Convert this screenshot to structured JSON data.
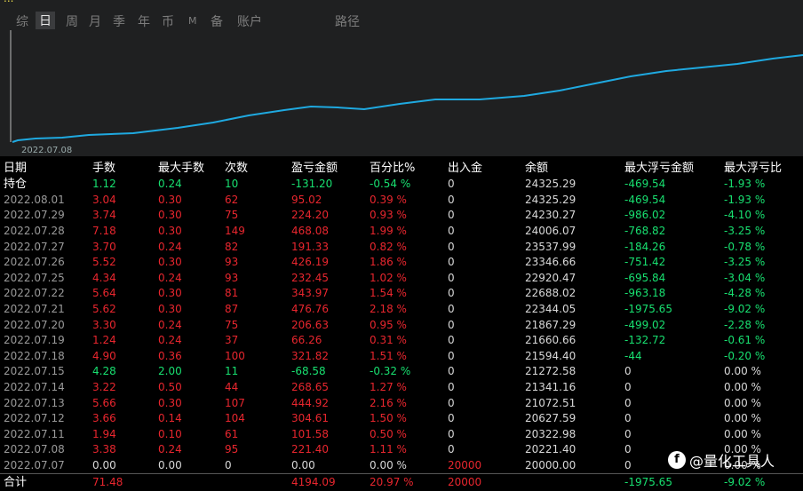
{
  "window": {
    "title": "..."
  },
  "tabs": [
    "综",
    "日",
    "周",
    "月",
    "季",
    "年",
    "币",
    "M",
    "备",
    "账户",
    "路径"
  ],
  "active_tab": "日",
  "chart": {
    "start_label": "2022.07.08",
    "line_color": "#1fa9e0"
  },
  "table": {
    "headers": [
      "日期",
      "手数",
      "最大手数",
      "次数",
      "盈亏金额",
      "百分比%",
      "出入金",
      "余额",
      "最大浮亏金额",
      "最大浮亏比"
    ],
    "hold_row": [
      "持仓",
      "1.12",
      "0.24",
      "10",
      "-131.20",
      "-0.54 %",
      "0",
      "24325.29",
      "-469.54",
      "-1.93 %"
    ],
    "rows": [
      [
        "2022.08.01",
        "3.04",
        "0.30",
        "62",
        "95.02",
        "0.39 %",
        "0",
        "24325.29",
        "-469.54",
        "-1.93 %"
      ],
      [
        "2022.07.29",
        "3.74",
        "0.30",
        "75",
        "224.20",
        "0.93 %",
        "0",
        "24230.27",
        "-986.02",
        "-4.10 %"
      ],
      [
        "2022.07.28",
        "7.18",
        "0.30",
        "149",
        "468.08",
        "1.99 %",
        "0",
        "24006.07",
        "-768.82",
        "-3.25 %"
      ],
      [
        "2022.07.27",
        "3.70",
        "0.24",
        "82",
        "191.33",
        "0.82 %",
        "0",
        "23537.99",
        "-184.26",
        "-0.78 %"
      ],
      [
        "2022.07.26",
        "5.52",
        "0.30",
        "93",
        "426.19",
        "1.86 %",
        "0",
        "23346.66",
        "-751.42",
        "-3.25 %"
      ],
      [
        "2022.07.25",
        "4.34",
        "0.24",
        "93",
        "232.45",
        "1.02 %",
        "0",
        "22920.47",
        "-695.84",
        "-3.04 %"
      ],
      [
        "2022.07.22",
        "5.64",
        "0.30",
        "81",
        "343.97",
        "1.54 %",
        "0",
        "22688.02",
        "-963.18",
        "-4.28 %"
      ],
      [
        "2022.07.21",
        "5.62",
        "0.30",
        "87",
        "476.76",
        "2.18 %",
        "0",
        "22344.05",
        "-1975.65",
        "-9.02 %"
      ],
      [
        "2022.07.20",
        "3.30",
        "0.24",
        "75",
        "206.63",
        "0.95 %",
        "0",
        "21867.29",
        "-499.02",
        "-2.28 %"
      ],
      [
        "2022.07.19",
        "1.24",
        "0.24",
        "37",
        "66.26",
        "0.31 %",
        "0",
        "21660.66",
        "-132.72",
        "-0.61 %"
      ],
      [
        "2022.07.18",
        "4.90",
        "0.36",
        "100",
        "321.82",
        "1.51 %",
        "0",
        "21594.40",
        "-44",
        "-0.20 %"
      ],
      [
        "2022.07.15",
        "4.28",
        "2.00",
        "11",
        "-68.58",
        "-0.32 %",
        "0",
        "21272.58",
        "0",
        "0.00 %"
      ],
      [
        "2022.07.14",
        "3.22",
        "0.50",
        "44",
        "268.65",
        "1.27 %",
        "0",
        "21341.16",
        "0",
        "0.00 %"
      ],
      [
        "2022.07.13",
        "5.66",
        "0.30",
        "107",
        "444.92",
        "2.16 %",
        "0",
        "21072.51",
        "0",
        "0.00 %"
      ],
      [
        "2022.07.12",
        "3.66",
        "0.14",
        "104",
        "304.61",
        "1.50 %",
        "0",
        "20627.59",
        "0",
        "0.00 %"
      ],
      [
        "2022.07.11",
        "1.94",
        "0.10",
        "61",
        "101.58",
        "0.50 %",
        "0",
        "20322.98",
        "0",
        "0.00 %"
      ],
      [
        "2022.07.08",
        "3.38",
        "0.24",
        "95",
        "221.40",
        "1.11 %",
        "0",
        "20221.40",
        "0",
        "0.00 %"
      ],
      [
        "2022.07.07",
        "0.00",
        "0.00",
        "0",
        "0.00",
        "0.00 %",
        "20000",
        "20000.00",
        "0",
        "0.00 %"
      ]
    ],
    "total_row": [
      "合计",
      "71.48",
      "",
      "",
      "4194.09",
      "20.97 %",
      "20000",
      "",
      "-1975.65",
      "-9.02 %"
    ]
  },
  "watermark": {
    "icon": "f",
    "text": "@量化工具人"
  }
}
